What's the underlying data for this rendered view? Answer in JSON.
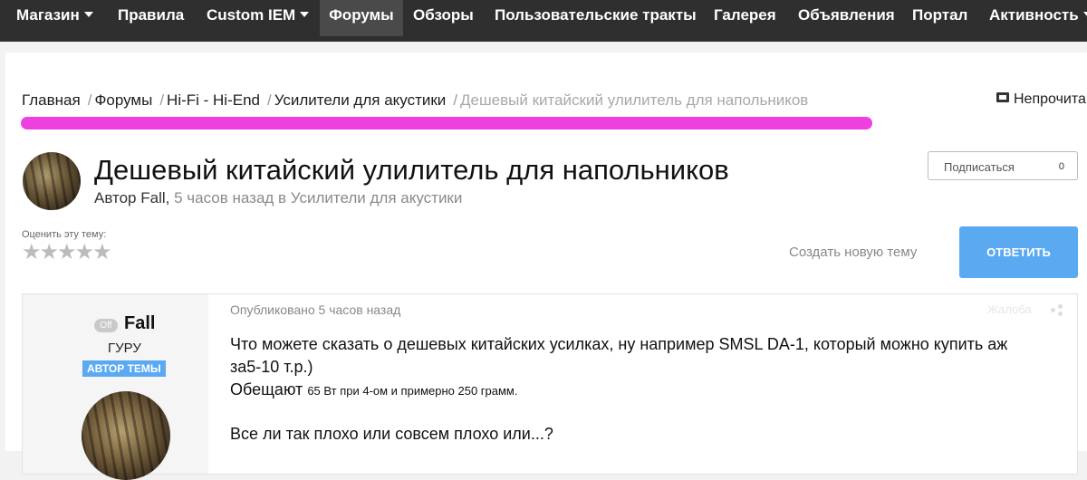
{
  "nav": {
    "items": [
      {
        "label": "Магазин",
        "dropdown": true
      },
      {
        "label": "Правила",
        "dropdown": false
      },
      {
        "label": "Custom IEM",
        "dropdown": true
      },
      {
        "label": "Форумы",
        "dropdown": false,
        "active": true
      },
      {
        "label": "Обзоры",
        "dropdown": false
      },
      {
        "label": "Пользовательские тракты",
        "dropdown": false
      },
      {
        "label": "Галерея",
        "dropdown": false
      },
      {
        "label": "Объявления",
        "dropdown": false
      },
      {
        "label": "Портал",
        "dropdown": false
      },
      {
        "label": "Активность",
        "dropdown": true
      }
    ]
  },
  "breadcrumb": {
    "items": [
      "Главная",
      "Форумы",
      "Hi-Fi - Hi-End",
      "Усилители для акустики"
    ],
    "current": "Дешевый китайский улилитель для напольников",
    "separator": "/"
  },
  "unread": {
    "label": "Непрочита",
    "icon": "unread-icon"
  },
  "topic": {
    "title": "Дешевый китайский улилитель для напольников",
    "author_prefix": "Автор",
    "author": "Fall,",
    "meta": "5 часов назад в Усилители для акустики"
  },
  "subscribe": {
    "label": "Подписаться",
    "count": "0"
  },
  "rating": {
    "label": "Оценить эту тему:",
    "stars": "★★★★★"
  },
  "actions": {
    "new_topic": "Создать новую тему",
    "reply": "ОТВЕТИТЬ"
  },
  "post": {
    "status": "Off",
    "author": "Fall",
    "rank": "ГУРУ",
    "badge": "АВТОР ТЕМЫ",
    "published": "Опубликовано 5 часов назад",
    "report": "Жалоба",
    "line1": "Что можете  сказать о дешевых китайских усилках, ну например SMSL DA-1, который можно купить аж",
    "line2": "за5-10 т.р.)",
    "line3_main": "Обещают",
    "line3_small": "65 Вт при 4-ом и примерно 250 грамм.",
    "line4": "Все ли так плохо или совсем плохо или...?"
  },
  "colors": {
    "nav_bg": "#2f2f2f",
    "accent": "#5aa9f1",
    "highlight": "#ee3fe0"
  }
}
